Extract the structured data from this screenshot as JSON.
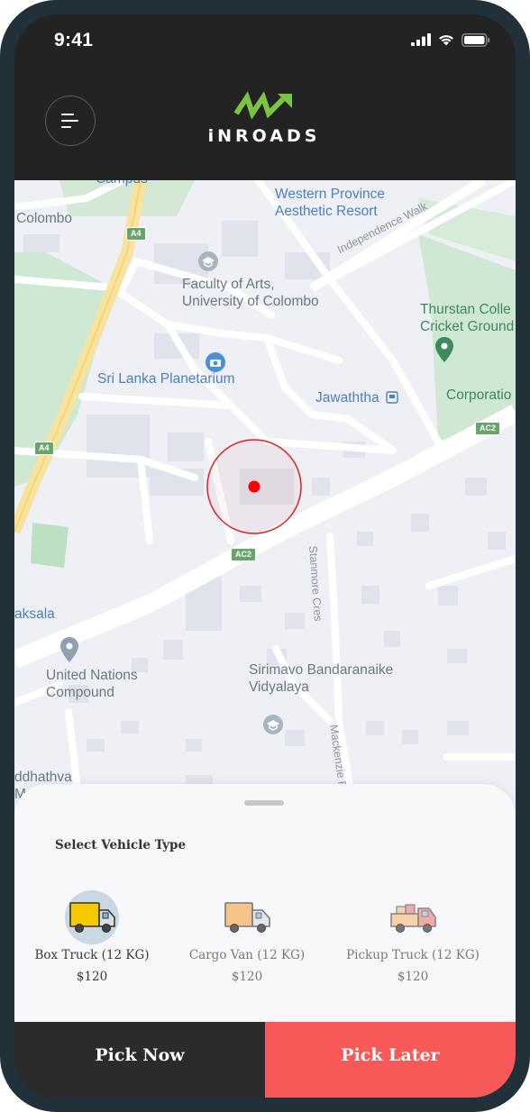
{
  "status_bar": {
    "time": "9:41"
  },
  "header": {
    "brand": "iNROADS",
    "brand_color": "#7cc243"
  },
  "map": {
    "labels": {
      "colombo": "Colombo",
      "western_province": "Western Province\nAesthetic Resort",
      "independence_walk": "Independence Walk",
      "faculty_arts": "Faculty of Arts,\nUniversity of Colombo",
      "thurstan": "Thurstan Colle\nCricket Ground",
      "planetarium": "Sri Lanka Planetarium",
      "jawaththa": "Jawaththa",
      "corporation": "Corporatio",
      "laksala": "aksala",
      "stanmore": "Stanmore Cres",
      "un_compound": "United Nations\nCompound",
      "sirimavo": "Sirimavo Bandaranaike\nVidyalaya",
      "mackenzie": "Mackenzie R",
      "buddhathva": "ddhathva\nMandi",
      "campus": "Campus"
    },
    "road_shields": {
      "a4_top": "A4",
      "a4_bottom": "A4",
      "ac2_right": "AC2",
      "ac2_center": "AC2"
    },
    "accent_colors": {
      "location_dot": "#ff0000",
      "location_ring": "#e0201f"
    }
  },
  "sheet": {
    "title": "Select Vehicle Type",
    "vehicles": [
      {
        "name": "Box Truck (12 KG)",
        "price": "$120",
        "icon": "box-truck-icon",
        "selected": true
      },
      {
        "name": "Cargo Van (12 KG)",
        "price": "$120",
        "icon": "cargo-van-icon",
        "selected": false
      },
      {
        "name": "Pickup Truck (12 KG)",
        "price": "$120",
        "icon": "pickup-truck-icon",
        "selected": false
      }
    ]
  },
  "actions": {
    "pick_now": "Pick Now",
    "pick_later": "Pick Later",
    "pick_now_color": "#2b2b2b",
    "pick_later_color": "#f75858"
  }
}
